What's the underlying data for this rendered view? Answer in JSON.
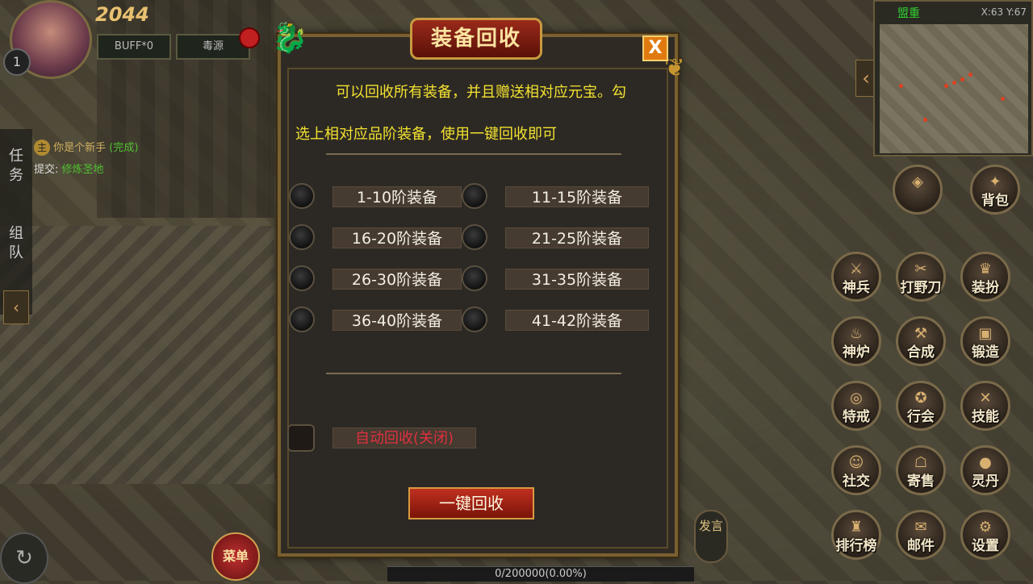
{
  "player": {
    "level": "2044",
    "badge": "1",
    "buff_label": "BUFF*0",
    "poison_label": "毒源"
  },
  "side_tabs": [
    "任务",
    "组队"
  ],
  "quest": {
    "tag": "主",
    "title": "你是个新手",
    "status": "(完成)",
    "submit_label": "提交:",
    "submit_target": "修炼圣地"
  },
  "minimap": {
    "name": "盟重",
    "coords": "X:63 Y:67"
  },
  "feature_buttons": [
    "背包",
    "神兵",
    "打野刀",
    "装扮",
    "神炉",
    "合成",
    "锻造",
    "特戒",
    "行会",
    "技能",
    "社交",
    "寄售",
    "灵丹",
    "排行榜",
    "邮件",
    "设置"
  ],
  "bottom": {
    "menu_label": "菜单",
    "speak_label": "发言",
    "exp_text": "0/200000(0.00%)"
  },
  "dialog": {
    "title": "装备回收",
    "close": "X",
    "description_line1": "可以回收所有装备，并且赠送相对应元宝。勾",
    "description_line2": "选上相对应品阶装备，使用一键回收即可",
    "tiers": [
      "1-10阶装备",
      "11-15阶装备",
      "16-20阶装备",
      "21-25阶装备",
      "26-30阶装备",
      "31-35阶装备",
      "36-40阶装备",
      "41-42阶装备"
    ],
    "auto_recycle_label": "自动回收(关闭)",
    "one_click_label": "一键回收",
    "colors": {
      "description": "#f4e230",
      "auto_off": "#e03040",
      "accent": "#c89a40"
    }
  }
}
